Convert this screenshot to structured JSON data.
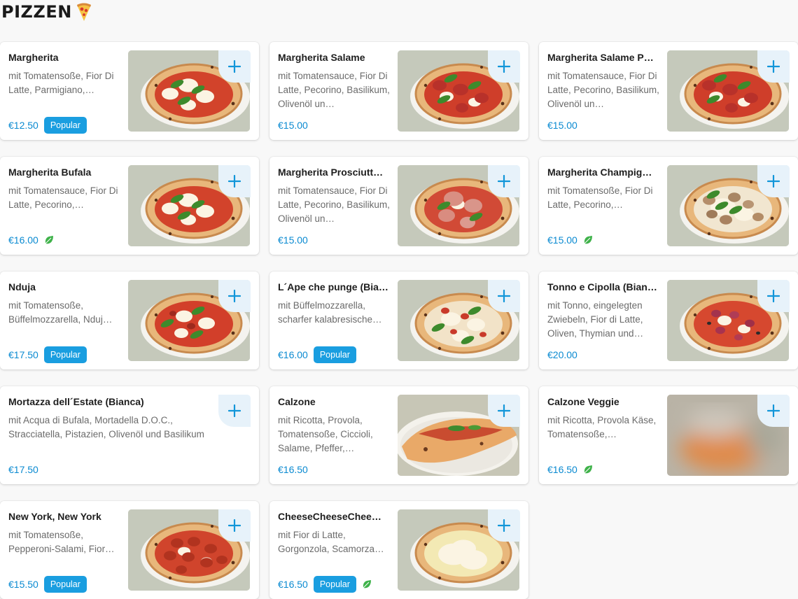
{
  "section": {
    "title": "PIZZEN",
    "title_icon": "pizza-slice-icon"
  },
  "colors": {
    "accent": "#0a8ad1",
    "badge_bg": "#1a9ee0",
    "add_button_bg": "#e7f2fa",
    "vegetarian": "#3fb24a"
  },
  "items": [
    {
      "name": "Margherita",
      "desc": "mit Tomatensoße, Fior Di Latte, Parmigiano,…",
      "price": "€12.50",
      "badge": "Popular",
      "veg": false,
      "image": "margherita"
    },
    {
      "name": "Margherita Salame",
      "desc": "mit Tomatensauce, Fior Di Latte, Pecorino, Basilikum, Olivenöl un…",
      "price": "€15.00",
      "badge": "",
      "veg": false,
      "image": "salame"
    },
    {
      "name": "Margherita Salame P…",
      "desc": "mit Tomatensauce, Fior Di Latte, Pecorino, Basilikum, Olivenöl un…",
      "price": "€15.00",
      "badge": "",
      "veg": false,
      "image": "salame"
    },
    {
      "name": "Margherita Bufala",
      "desc": "mit Tomatensauce, Fior Di Latte, Pecorino,…",
      "price": "€16.00",
      "badge": "",
      "veg": true,
      "image": "margherita"
    },
    {
      "name": "Margherita Prosciutt…",
      "desc": "mit Tomatensauce, Fior Di Latte, Pecorino, Basilikum, Olivenöl un…",
      "price": "€15.00",
      "badge": "",
      "veg": false,
      "image": "prosciutto"
    },
    {
      "name": "Margherita Champig…",
      "desc": "mit Tomatensoße, Fior Di Latte, Pecorino,…",
      "price": "€15.00",
      "badge": "",
      "veg": true,
      "image": "champignon"
    },
    {
      "name": "Nduja",
      "desc": "mit Tomatensoße, Büffelmozzarella, Nduj…",
      "price": "€17.50",
      "badge": "Popular",
      "veg": false,
      "image": "nduja"
    },
    {
      "name": "L´Ape che punge (Bia…",
      "desc": "mit Büffelmozzarella, scharfer kalabresische…",
      "price": "€16.00",
      "badge": "Popular",
      "veg": false,
      "image": "ape"
    },
    {
      "name": "Tonno e Cipolla (Bian…",
      "desc": "mit Tonno, eingelegten Zwiebeln, Fior di Latte, Oliven, Thymian und…",
      "price": "€20.00",
      "badge": "",
      "veg": false,
      "image": "tonno"
    },
    {
      "name": "Mortazza dell´Estate (Bianca)",
      "desc": "mit Acqua di Bufala, Mortadella D.O.C., Stracciatella, Pistazien, Olivenöl und Basilikum",
      "price": "€17.50",
      "badge": "",
      "veg": false,
      "image": ""
    },
    {
      "name": "Calzone",
      "desc": "mit Ricotta, Provola, Tomatensoße, Ciccioli, Salame, Pfeffer,…",
      "price": "€16.50",
      "badge": "",
      "veg": false,
      "image": "calzone"
    },
    {
      "name": "Calzone Veggie",
      "desc": "mit Ricotta, Provola Käse, Tomatensoße,…",
      "price": "€16.50",
      "badge": "",
      "veg": true,
      "image": "blurred"
    },
    {
      "name": "New York, New York",
      "desc": "mit Tomatensoße, Pepperoni-Salami, Fior…",
      "price": "€15.50",
      "badge": "Popular",
      "veg": false,
      "image": "newyork"
    },
    {
      "name": "CheeseCheeseChee…",
      "desc": "mit Fior di Latte, Gorgonzola, Scamorza…",
      "price": "€16.50",
      "badge": "Popular",
      "veg": true,
      "image": "cheese"
    }
  ]
}
